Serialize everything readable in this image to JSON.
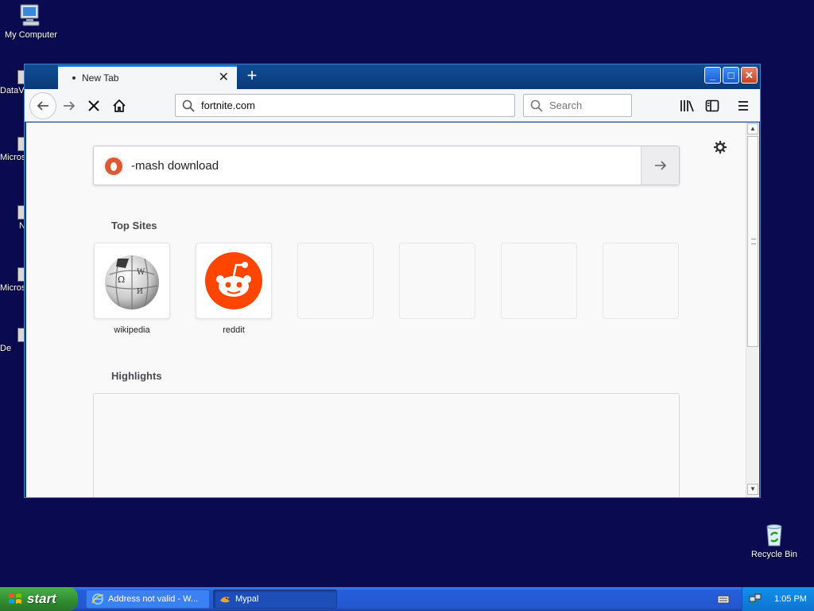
{
  "desktop": {
    "my_computer": "My Computer",
    "recycle_bin": "Recycle Bin",
    "partial_icons": [
      "DataV",
      "Micros C+",
      "N",
      "Micros Ba",
      "De"
    ]
  },
  "browser": {
    "tab_title": "New Tab",
    "url": "fortnite.com",
    "search_placeholder": "Search",
    "page_search_query": "-mash download",
    "top_sites_heading": "Top Sites",
    "highlights_heading": "Highlights",
    "top_sites": [
      {
        "label": "wikipedia",
        "icon": "wikipedia-globe-icon"
      },
      {
        "label": "reddit",
        "icon": "reddit-alien-icon"
      },
      {
        "label": ""
      },
      {
        "label": ""
      },
      {
        "label": ""
      },
      {
        "label": ""
      }
    ],
    "colors": {
      "reddit": "#ff4500",
      "duckduckgo": "#de5833",
      "accent": "#0a84ff"
    }
  },
  "taskbar": {
    "start_label": "start",
    "tasks": [
      "Address not valid - W...",
      "Mypal"
    ],
    "clock": "1:05 PM"
  }
}
